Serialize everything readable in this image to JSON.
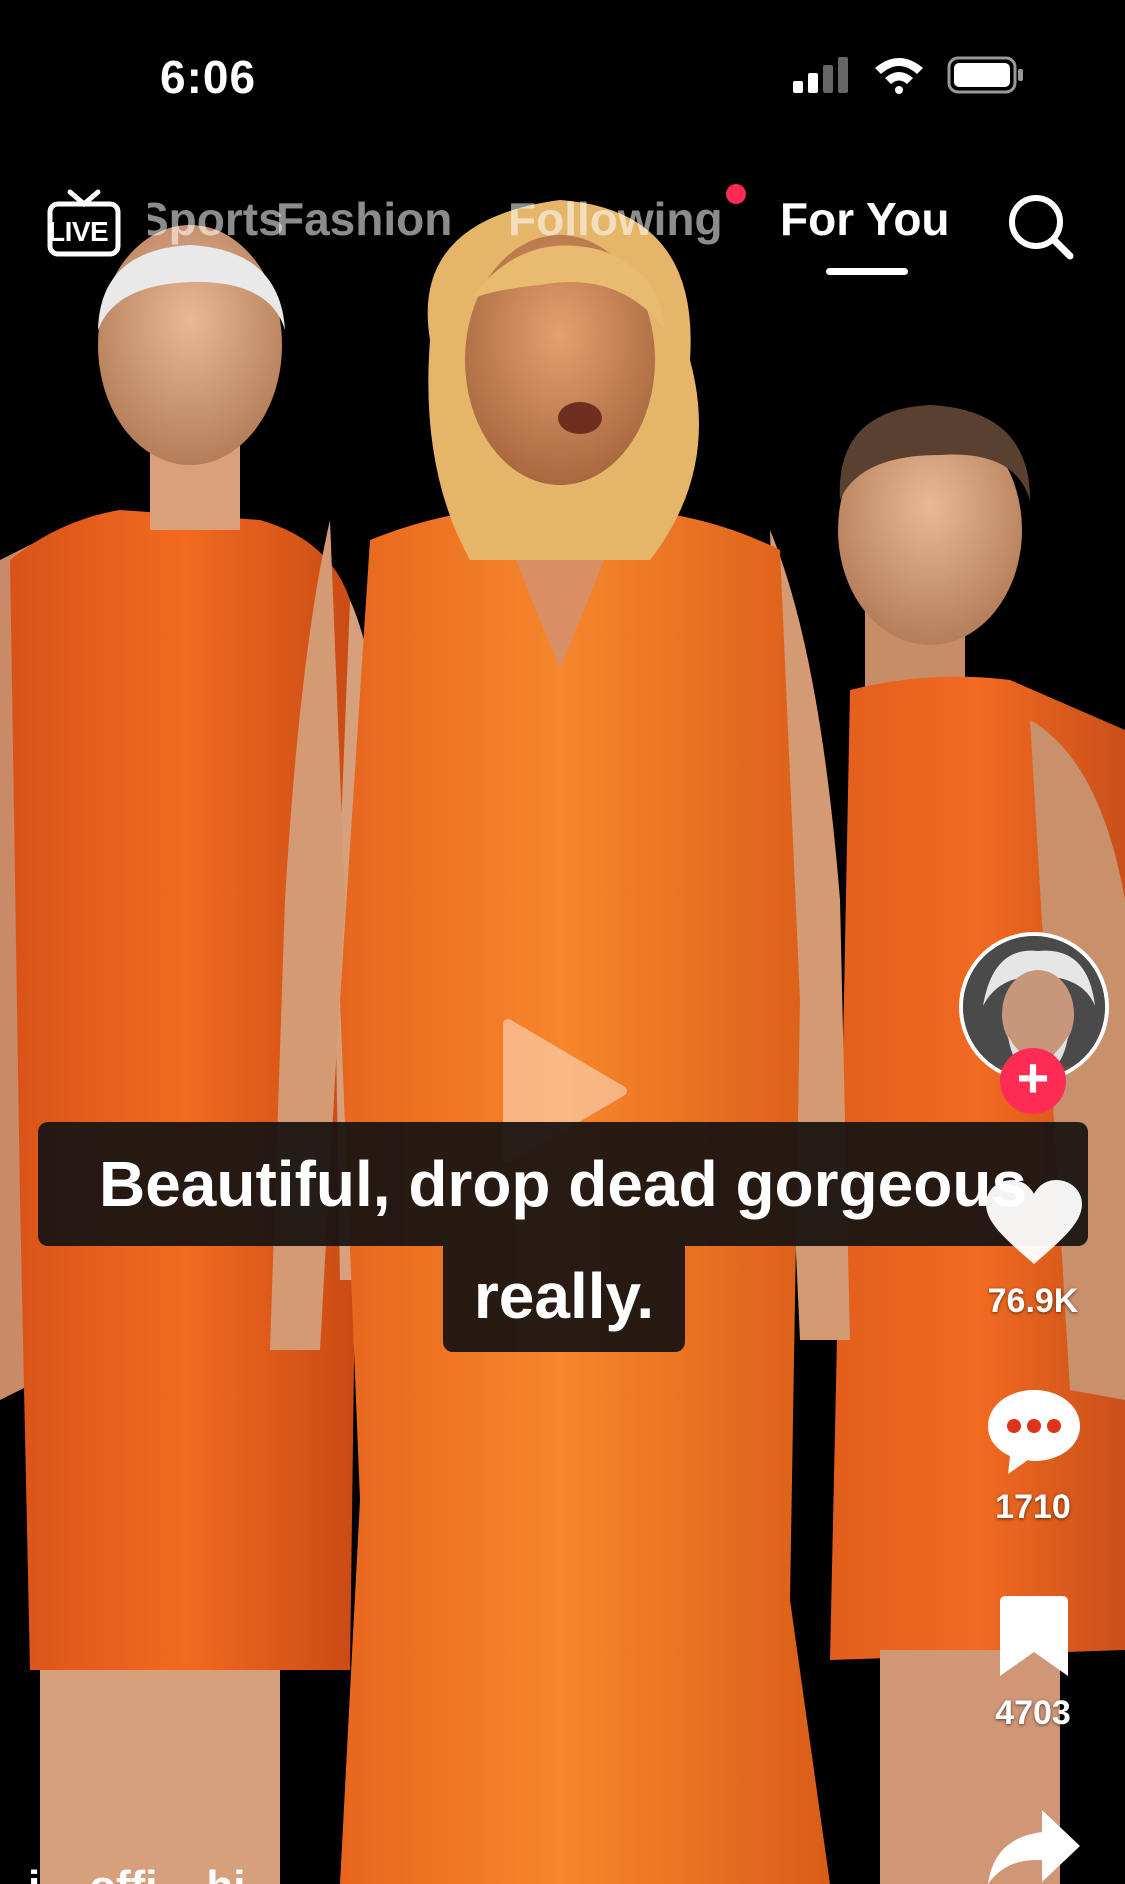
{
  "status_bar": {
    "time": "6:06",
    "signal_icon": "cellular-signal-icon",
    "wifi_icon": "wifi-icon",
    "battery_icon": "battery-icon"
  },
  "top_nav": {
    "live_label": "LIVE",
    "tabs": [
      {
        "label": "Sports",
        "state": "partially-hidden"
      },
      {
        "label": "Fashion",
        "state": "inactive"
      },
      {
        "label": "Following",
        "state": "inactive",
        "has_notification_dot": true
      },
      {
        "label": "For You",
        "state": "active"
      }
    ],
    "search_icon": "search-icon"
  },
  "video": {
    "play_icon": "play-icon",
    "caption_line1": "Beautiful, drop dead gorgeous",
    "caption_line2": "really.",
    "bottom_description": "i... offi... hi..."
  },
  "actions": {
    "follow_label": "+",
    "likes": "76.9K",
    "comments": "1710",
    "saves": "4703",
    "share_icon": "share-icon"
  },
  "colors": {
    "accent": "#fe2c55",
    "dress": "#f26a1f",
    "background": "#000000"
  }
}
